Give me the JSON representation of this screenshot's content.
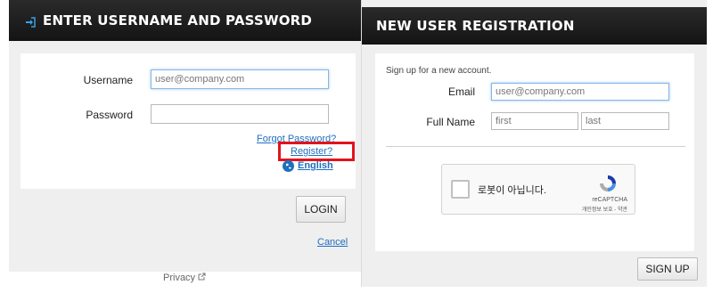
{
  "login": {
    "title": "ENTER USERNAME AND PASSWORD",
    "username_label": "Username",
    "username_value": "user@company.com",
    "password_label": "Password",
    "password_value": "",
    "forgot_link": "Forgot Password?",
    "register_link": "Register?",
    "language_link": "English",
    "login_button": "LOGIN",
    "cancel_link": "Cancel",
    "privacy_link": "Privacy"
  },
  "registration": {
    "title": "NEW USER REGISTRATION",
    "intro": "Sign up for a new account.",
    "email_label": "Email",
    "email_value": "user@company.com",
    "fullname_label": "Full Name",
    "first_placeholder": "first",
    "last_placeholder": "last",
    "captcha_text": "로봇이 아닙니다.",
    "captcha_brand": "reCAPTCHA",
    "captcha_sub": "개인정보 보호 - 약관",
    "signup_button": "SIGN UP"
  },
  "colors": {
    "link": "#1f6fbf",
    "highlight": "#e3131b",
    "header_bg": "#1c1c1c"
  },
  "icons": {
    "login_icon": "sign-in-icon",
    "globe_icon": "globe-icon",
    "external_icon": "external-link-icon",
    "recaptcha_logo": "recaptcha-logo"
  }
}
